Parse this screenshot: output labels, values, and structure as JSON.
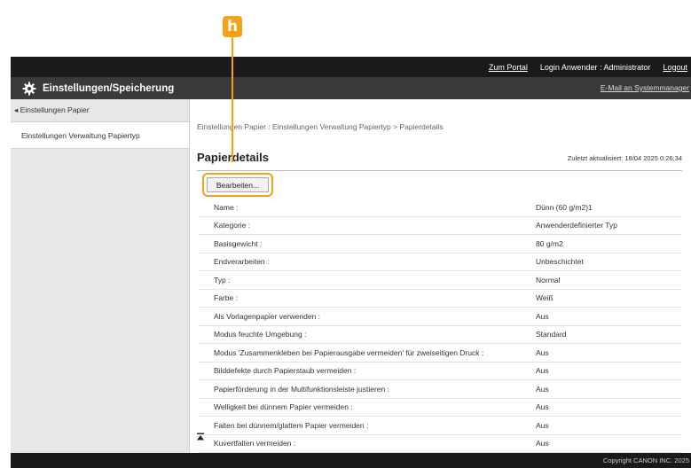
{
  "annotation": {
    "marker": "h"
  },
  "topbar": {
    "portal_link": "Zum Portal",
    "login_user": "Login Anwender : Administrator",
    "logout": "Logout"
  },
  "header": {
    "icon": "gear-icon",
    "title": "Einstellungen/Speicherung",
    "mail_link": "E-Mail an Systemmanager"
  },
  "sidebar": {
    "back_label": "◂ Einstellungen Papier",
    "items": [
      {
        "label": "Einstellungen Verwaltung Papiertyp"
      }
    ]
  },
  "main": {
    "breadcrumb": "Einstellungen Papier : Einstellungen Verwaltung Papiertyp > Papierdetails",
    "title": "Papierdetails",
    "last_update": "Zuletzt aktualisiert: 18/04 2025 0:26:34",
    "edit_button": "Bearbeiten...",
    "details": [
      {
        "label": "Name :",
        "value": "Dünn (60 g/m2)1"
      },
      {
        "label": "Kategorie :",
        "value": "Anwenderdefinierter Typ"
      },
      {
        "label": "Basisgewicht :",
        "value": "80 g/m2"
      },
      {
        "label": "Endverarbeiten :",
        "value": "Unbeschichtet"
      },
      {
        "label": "Typ :",
        "value": "Normal"
      },
      {
        "label": "Farbe :",
        "value": "Weiß"
      },
      {
        "label": "Als Vorlagenpapier verwenden :",
        "value": "Aus"
      },
      {
        "label": "Modus feuchte Umgebung :",
        "value": "Standard"
      },
      {
        "label": "Modus 'Zusammenkleben bei Papierausgabe vermeiden' für zweiseitigen Druck :",
        "value": "Aus"
      },
      {
        "label": "Bilddefekte durch Papierstaub vermeiden :",
        "value": "Aus"
      },
      {
        "label": "Papierförderung in der Multifunktionsleiste justieren :",
        "value": "Aus"
      },
      {
        "label": "Welligkeit bei dünnem Papier vermeiden :",
        "value": "Aus"
      },
      {
        "label": "Falten bei dünnem/glattem Papier vermeiden :",
        "value": "Aus"
      },
      {
        "label": "Kuvertfalten vermeiden :",
        "value": "Aus"
      }
    ]
  },
  "footer": {
    "copyright": "Copyright CANON INC. 2025"
  },
  "colors": {
    "accent": "#f5a015",
    "topbar": "#1a1a1a",
    "header": "#3a3a3a",
    "sidebar": "#e6e6e6"
  }
}
